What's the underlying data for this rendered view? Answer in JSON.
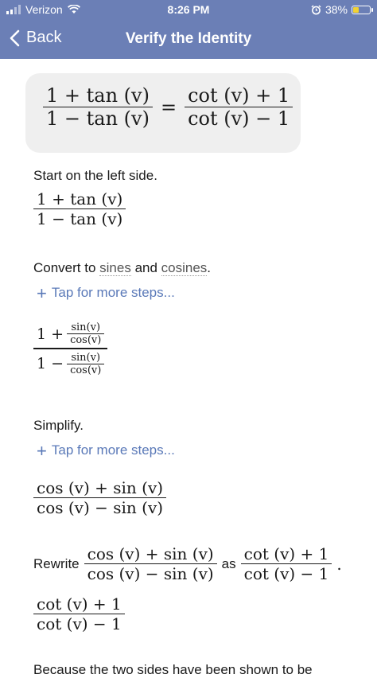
{
  "status_bar": {
    "carrier": "Verizon",
    "time": "8:26 PM",
    "battery": "38%",
    "battery_level": 0.38
  },
  "nav": {
    "back_label": "Back",
    "title": "Verify the Identity"
  },
  "identity": {
    "lhs_num": "1 + tan (v)",
    "lhs_den": "1 − tan (v)",
    "eq": "=",
    "rhs_num": "cot (v) + 1",
    "rhs_den": "cot (v) − 1"
  },
  "steps": {
    "s1_text": "Start on the left side.",
    "s1_num": "1 + tan (v)",
    "s1_den": "1 − tan (v)",
    "s2_prefix": "Convert to ",
    "s2_link1": "sines",
    "s2_and": " and ",
    "s2_link2": "cosines",
    "s2_period": ".",
    "tap_label": "Tap for more steps...",
    "s2_top_lead": "1 +",
    "s2_bot_lead": "1 −",
    "s2_sin": "sin(v)",
    "s2_cos": "cos(v)",
    "s3_text": "Simplify.",
    "s3_num": "cos (v) + sin (v)",
    "s3_den": "cos (v) − sin (v)",
    "s4_rewrite": "Rewrite",
    "s4_as": "as",
    "s4_period": ".",
    "final_num": "cot (v) + 1",
    "final_den": "cot (v) − 1",
    "cutoff_text": "Because the two sides have been shown to be"
  }
}
